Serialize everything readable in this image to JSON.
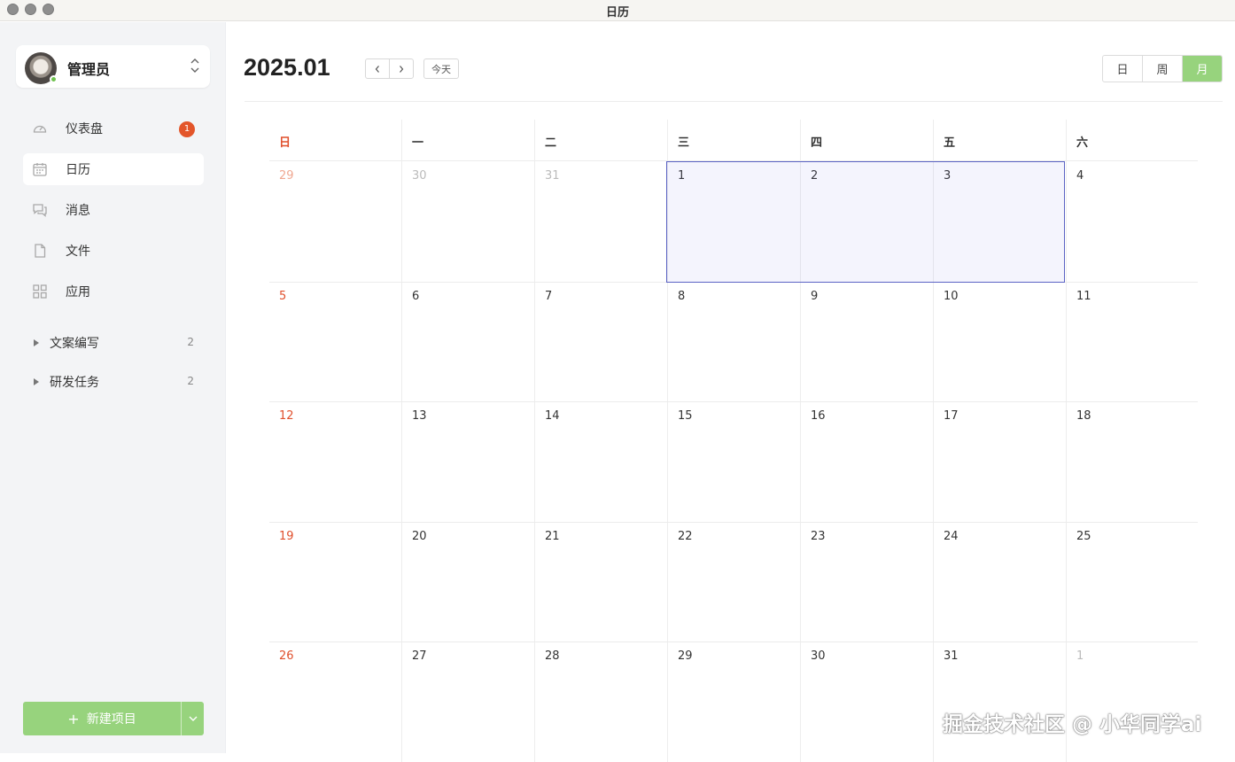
{
  "window": {
    "title": "日历"
  },
  "account": {
    "name": "管理员",
    "status": "online"
  },
  "sidebar": {
    "items": [
      {
        "label": "仪表盘",
        "icon": "dashboard-icon",
        "badge": "1"
      },
      {
        "label": "日历",
        "icon": "calendar-icon",
        "active": true
      },
      {
        "label": "消息",
        "icon": "message-icon"
      },
      {
        "label": "文件",
        "icon": "file-icon"
      },
      {
        "label": "应用",
        "icon": "apps-icon"
      }
    ],
    "groups": [
      {
        "label": "文案编写",
        "count": "2"
      },
      {
        "label": "研发任务",
        "count": "2"
      }
    ],
    "new_button": {
      "label": "新建项目"
    }
  },
  "header": {
    "month": "2025.01",
    "prev": "‹",
    "next": "›",
    "today": "今天",
    "views": [
      "日",
      "周",
      "月"
    ],
    "active_view": "月"
  },
  "calendar": {
    "weekdays": [
      "日",
      "一",
      "二",
      "三",
      "四",
      "五",
      "六"
    ],
    "weeks": [
      [
        "29",
        "30",
        "31",
        "1",
        "2",
        "3",
        "4"
      ],
      [
        "5",
        "6",
        "7",
        "8",
        "9",
        "10",
        "11"
      ],
      [
        "12",
        "13",
        "14",
        "15",
        "16",
        "17",
        "18"
      ],
      [
        "19",
        "20",
        "21",
        "22",
        "23",
        "24",
        "25"
      ],
      [
        "26",
        "27",
        "28",
        "29",
        "30",
        "31",
        "1"
      ]
    ],
    "selected_range": [
      "2025-01-01",
      "2025-01-03"
    ]
  },
  "watermark": "掘金技术社区 @ 小华同学ai",
  "colors": {
    "accent": "#97d37d",
    "sunday": "#e0502d",
    "badge": "#e3552a",
    "selection": "#5b63c4"
  }
}
